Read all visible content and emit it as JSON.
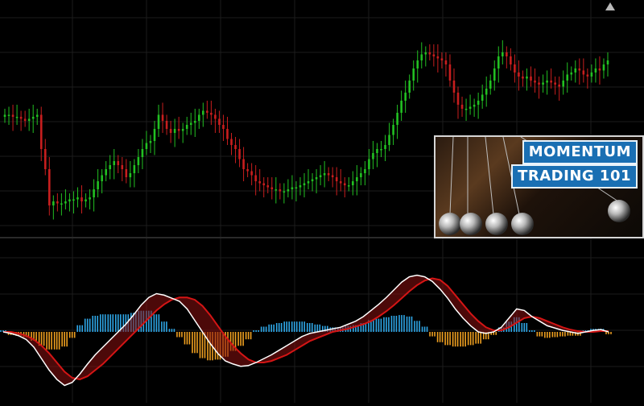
{
  "chart_data": [
    {
      "type": "candlestick",
      "title": "",
      "grid": true,
      "background": "#000000",
      "up_color": "#22c022",
      "down_color": "#c81e1e",
      "ylim": [
        0,
        100
      ],
      "x": [
        1,
        2,
        3,
        4,
        5,
        6,
        7,
        8,
        9,
        10,
        11,
        12,
        13,
        14,
        15,
        16,
        17,
        18,
        19,
        20,
        21,
        22,
        23,
        24,
        25,
        26,
        27,
        28,
        29,
        30,
        31,
        32,
        33,
        34,
        35,
        36,
        37,
        38,
        39,
        40,
        41,
        42,
        43,
        44,
        45,
        46,
        47,
        48,
        49,
        50,
        51,
        52,
        53,
        54,
        55,
        56,
        57,
        58,
        59,
        60,
        61,
        62,
        63,
        64,
        65,
        66,
        67,
        68,
        69,
        70,
        71,
        72,
        73,
        74,
        75,
        76,
        77,
        78,
        79,
        80,
        81,
        82,
        83,
        84,
        85,
        86,
        87,
        88,
        89,
        90,
        91,
        92,
        93,
        94,
        95,
        96,
        97,
        98,
        99,
        100,
        101,
        102,
        103,
        104,
        105,
        106,
        107,
        108,
        109,
        110,
        111,
        112,
        113,
        114,
        115,
        116,
        117,
        118,
        119,
        120,
        121,
        122,
        123,
        124,
        125,
        126,
        127,
        128,
        129,
        130,
        131,
        132,
        133,
        134,
        135,
        136,
        137,
        138,
        139,
        140,
        141,
        142,
        143,
        144,
        145,
        146,
        147,
        148,
        149,
        150
      ],
      "close": [
        55,
        55,
        54,
        54,
        53,
        52,
        53,
        54,
        55,
        38,
        28,
        10,
        12,
        11,
        11,
        12,
        13,
        13,
        14,
        12,
        13,
        14,
        18,
        22,
        25,
        28,
        30,
        32,
        30,
        28,
        24,
        26,
        30,
        34,
        38,
        41,
        42,
        48,
        55,
        52,
        48,
        46,
        48,
        47,
        48,
        50,
        51,
        52,
        55,
        57,
        56,
        55,
        53,
        50,
        48,
        43,
        40,
        38,
        33,
        28,
        27,
        25,
        22,
        21,
        20,
        19,
        18,
        18,
        17,
        17,
        18,
        19,
        19,
        20,
        21,
        22,
        23,
        24,
        25,
        26,
        25,
        24,
        22,
        21,
        20,
        20,
        22,
        24,
        26,
        28,
        33,
        36,
        38,
        38,
        40,
        45,
        50,
        56,
        62,
        66,
        72,
        78,
        82,
        85,
        86,
        85,
        84,
        83,
        82,
        80,
        72,
        66,
        60,
        58,
        58,
        59,
        60,
        62,
        65,
        68,
        72,
        78,
        84,
        86,
        84,
        80,
        76,
        74,
        73,
        74,
        72,
        71,
        70,
        71,
        72,
        71,
        70,
        69,
        72,
        75,
        76,
        78,
        77,
        75,
        74,
        76,
        78,
        77,
        80,
        82
      ],
      "series_lines_note": "",
      "macd": {
        "zero_line": 0,
        "ylim": [
          -1,
          1
        ],
        "macd_line": [
          0.0,
          -0.02,
          -0.05,
          -0.1,
          -0.2,
          -0.35,
          -0.5,
          -0.62,
          -0.7,
          -0.66,
          -0.55,
          -0.42,
          -0.3,
          -0.2,
          -0.1,
          0.0,
          0.1,
          0.22,
          0.35,
          0.45,
          0.5,
          0.48,
          0.44,
          0.4,
          0.3,
          0.15,
          0.0,
          -0.15,
          -0.28,
          -0.38,
          -0.42,
          -0.45,
          -0.44,
          -0.4,
          -0.35,
          -0.3,
          -0.24,
          -0.18,
          -0.12,
          -0.06,
          -0.02,
          0.0,
          0.02,
          0.04,
          0.06,
          0.1,
          0.14,
          0.2,
          0.28,
          0.36,
          0.45,
          0.55,
          0.65,
          0.72,
          0.74,
          0.72,
          0.66,
          0.56,
          0.44,
          0.3,
          0.18,
          0.08,
          0.0,
          -0.02,
          0.0,
          0.06,
          0.18,
          0.3,
          0.28,
          0.2,
          0.14,
          0.08,
          0.05,
          0.02,
          0.0,
          -0.02,
          0.0,
          0.02,
          0.03,
          0.0
        ],
        "signal_line": [
          0.0,
          0.0,
          -0.02,
          -0.05,
          -0.1,
          -0.18,
          -0.28,
          -0.4,
          -0.52,
          -0.6,
          -0.62,
          -0.58,
          -0.5,
          -0.42,
          -0.32,
          -0.22,
          -0.12,
          -0.02,
          0.08,
          0.18,
          0.28,
          0.36,
          0.42,
          0.45,
          0.45,
          0.42,
          0.34,
          0.22,
          0.08,
          -0.06,
          -0.18,
          -0.28,
          -0.36,
          -0.4,
          -0.4,
          -0.38,
          -0.34,
          -0.3,
          -0.24,
          -0.18,
          -0.12,
          -0.08,
          -0.04,
          0.0,
          0.02,
          0.04,
          0.07,
          0.1,
          0.14,
          0.2,
          0.27,
          0.35,
          0.44,
          0.53,
          0.61,
          0.67,
          0.7,
          0.68,
          0.6,
          0.48,
          0.36,
          0.24,
          0.14,
          0.06,
          0.02,
          0.02,
          0.06,
          0.12,
          0.18,
          0.2,
          0.18,
          0.14,
          0.1,
          0.06,
          0.03,
          0.01,
          0.0,
          0.0,
          0.01,
          0.01
        ],
        "histogram_up_color": "#2ea6e6",
        "histogram_down_color": "#f0a020",
        "macd_line_color": "#ffffff",
        "signal_line_color": "#d41515"
      }
    }
  ],
  "overlay": {
    "line1": "MOMENTUM",
    "line2": "TRADING 101"
  },
  "colors": {
    "grid": "#1c1c1c",
    "panel_divider": "#2a2a2a",
    "banner_bg": "#1a6fb3"
  },
  "icons": {
    "scroll": "triangle-up-icon"
  }
}
